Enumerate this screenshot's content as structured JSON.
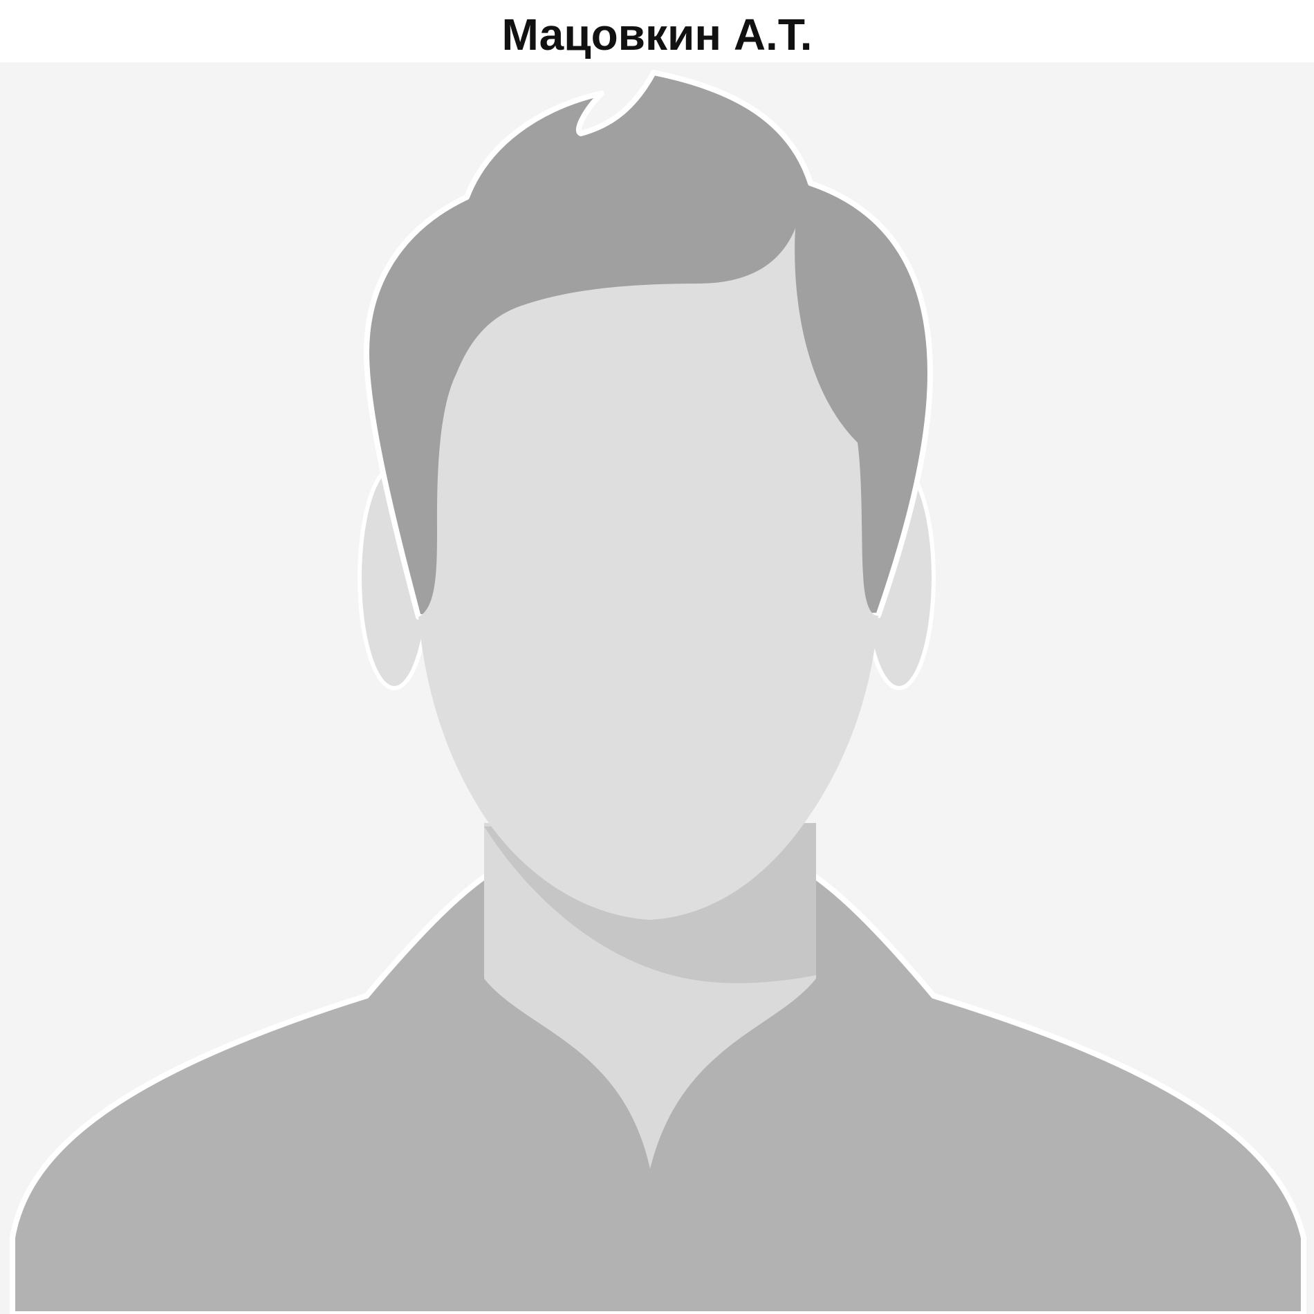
{
  "profile": {
    "name": "Мацовкин А.Т."
  },
  "avatar": {
    "icon": "default-user-silhouette-icon",
    "colors": {
      "background": "#f4f4f4",
      "outline": "#ffffff",
      "hair": "#a0a0a0",
      "face": "#dedede",
      "neck": "#dadada",
      "neck_shadow": "#c7c6c6",
      "shirt": "#b2b2b2"
    }
  }
}
